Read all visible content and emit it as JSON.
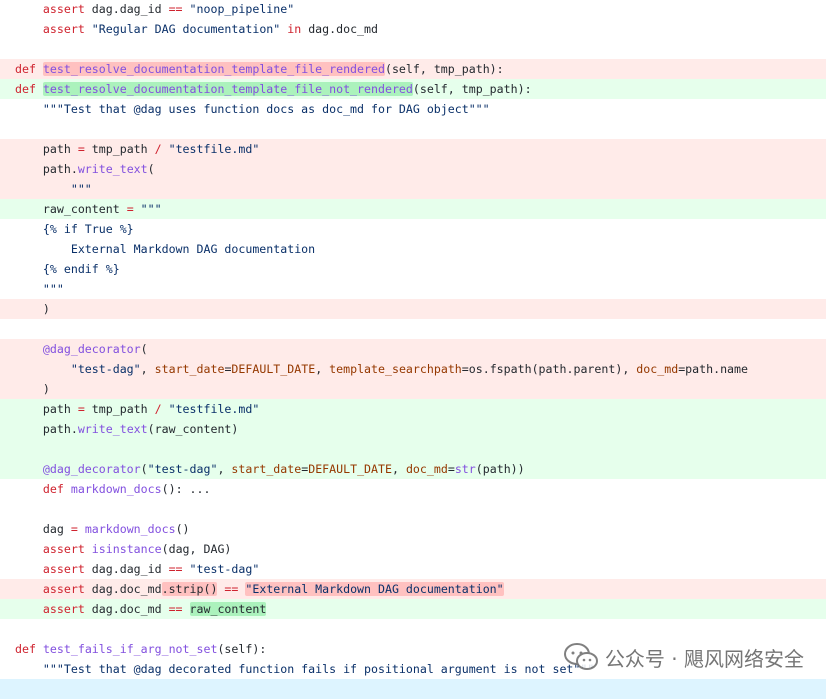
{
  "diff_lines": [
    {
      "type": "context",
      "tokens": [
        {
          "t": "    "
        },
        {
          "t": "assert",
          "c": "kw"
        },
        {
          "t": " dag.dag_id "
        },
        {
          "t": "==",
          "c": "op"
        },
        {
          "t": " "
        },
        {
          "t": "\"noop_pipeline\"",
          "c": "str"
        }
      ]
    },
    {
      "type": "context",
      "tokens": [
        {
          "t": "    "
        },
        {
          "t": "assert",
          "c": "kw"
        },
        {
          "t": " "
        },
        {
          "t": "\"Regular DAG documentation\"",
          "c": "str"
        },
        {
          "t": " "
        },
        {
          "t": "in",
          "c": "kw"
        },
        {
          "t": " dag.doc_md"
        }
      ]
    },
    {
      "type": "context",
      "tokens": []
    },
    {
      "type": "removed",
      "tokens": [
        {
          "t": "def",
          "c": "kw"
        },
        {
          "t": " "
        },
        {
          "t": "test_resolve_documentation_template_file_rendered",
          "c": "fn",
          "hl": true
        },
        {
          "t": "(self, tmp_path):"
        }
      ]
    },
    {
      "type": "added",
      "tokens": [
        {
          "t": "def",
          "c": "kw"
        },
        {
          "t": " "
        },
        {
          "t": "test_resolve_documentation_template_file_not_rendered",
          "c": "fn",
          "hl": true
        },
        {
          "t": "(self, tmp_path):"
        }
      ]
    },
    {
      "type": "context",
      "tokens": [
        {
          "t": "    "
        },
        {
          "t": "\"\"\"Test that @dag uses function docs as doc_md for DAG object\"\"\"",
          "c": "str"
        }
      ]
    },
    {
      "type": "context",
      "tokens": []
    },
    {
      "type": "removed",
      "tokens": [
        {
          "t": "    path "
        },
        {
          "t": "=",
          "c": "op"
        },
        {
          "t": " tmp_path "
        },
        {
          "t": "/",
          "c": "op"
        },
        {
          "t": " "
        },
        {
          "t": "\"testfile.md\"",
          "c": "str"
        }
      ]
    },
    {
      "type": "removed",
      "tokens": [
        {
          "t": "    path."
        },
        {
          "t": "write_text",
          "c": "fn"
        },
        {
          "t": "("
        }
      ]
    },
    {
      "type": "removed",
      "tokens": [
        {
          "t": "        "
        },
        {
          "t": "\"\"\"",
          "c": "str"
        }
      ]
    },
    {
      "type": "added",
      "tokens": [
        {
          "t": "    raw_content "
        },
        {
          "t": "=",
          "c": "op"
        },
        {
          "t": " "
        },
        {
          "t": "\"\"\"",
          "c": "str"
        }
      ]
    },
    {
      "type": "context",
      "tokens": [
        {
          "t": "    "
        },
        {
          "t": "{% if True %}",
          "c": "str"
        }
      ]
    },
    {
      "type": "context",
      "tokens": [
        {
          "t": "        "
        },
        {
          "t": "External Markdown DAG documentation",
          "c": "str"
        }
      ]
    },
    {
      "type": "context",
      "tokens": [
        {
          "t": "    "
        },
        {
          "t": "{% endif %}",
          "c": "str"
        }
      ]
    },
    {
      "type": "context",
      "tokens": [
        {
          "t": "    "
        },
        {
          "t": "\"\"\"",
          "c": "str"
        }
      ]
    },
    {
      "type": "removed",
      "tokens": [
        {
          "t": "    )"
        }
      ]
    },
    {
      "type": "context",
      "tokens": []
    },
    {
      "type": "removed",
      "tokens": [
        {
          "t": "    "
        },
        {
          "t": "@dag_decorator",
          "c": "dec"
        },
        {
          "t": "("
        }
      ]
    },
    {
      "type": "removed",
      "tokens": [
        {
          "t": "        "
        },
        {
          "t": "\"test-dag\"",
          "c": "str"
        },
        {
          "t": ", "
        },
        {
          "t": "start_date",
          "c": "param"
        },
        {
          "t": "="
        },
        {
          "t": "DEFAULT_DATE",
          "c": "const"
        },
        {
          "t": ", "
        },
        {
          "t": "template_searchpath",
          "c": "param"
        },
        {
          "t": "=os.fspath(path.parent), "
        },
        {
          "t": "doc_md",
          "c": "param"
        },
        {
          "t": "=path.name"
        }
      ]
    },
    {
      "type": "removed",
      "tokens": [
        {
          "t": "    )"
        }
      ]
    },
    {
      "type": "added",
      "tokens": [
        {
          "t": "    path "
        },
        {
          "t": "=",
          "c": "op"
        },
        {
          "t": " tmp_path "
        },
        {
          "t": "/",
          "c": "op"
        },
        {
          "t": " "
        },
        {
          "t": "\"testfile.md\"",
          "c": "str"
        }
      ]
    },
    {
      "type": "added",
      "tokens": [
        {
          "t": "    path."
        },
        {
          "t": "write_text",
          "c": "fn"
        },
        {
          "t": "(raw_content)"
        }
      ]
    },
    {
      "type": "added",
      "tokens": []
    },
    {
      "type": "added",
      "tokens": [
        {
          "t": "    "
        },
        {
          "t": "@dag_decorator",
          "c": "dec"
        },
        {
          "t": "("
        },
        {
          "t": "\"test-dag\"",
          "c": "str"
        },
        {
          "t": ", "
        },
        {
          "t": "start_date",
          "c": "param"
        },
        {
          "t": "="
        },
        {
          "t": "DEFAULT_DATE",
          "c": "const"
        },
        {
          "t": ", "
        },
        {
          "t": "doc_md",
          "c": "param"
        },
        {
          "t": "="
        },
        {
          "t": "str",
          "c": "fn"
        },
        {
          "t": "(path))"
        }
      ]
    },
    {
      "type": "context",
      "tokens": [
        {
          "t": "    "
        },
        {
          "t": "def",
          "c": "kw"
        },
        {
          "t": " "
        },
        {
          "t": "markdown_docs",
          "c": "fn"
        },
        {
          "t": "(): ..."
        }
      ]
    },
    {
      "type": "context",
      "tokens": []
    },
    {
      "type": "context",
      "tokens": [
        {
          "t": "    dag "
        },
        {
          "t": "=",
          "c": "op"
        },
        {
          "t": " "
        },
        {
          "t": "markdown_docs",
          "c": "fn"
        },
        {
          "t": "()"
        }
      ]
    },
    {
      "type": "context",
      "tokens": [
        {
          "t": "    "
        },
        {
          "t": "assert",
          "c": "kw"
        },
        {
          "t": " "
        },
        {
          "t": "isinstance",
          "c": "fn"
        },
        {
          "t": "(dag, DAG)"
        }
      ]
    },
    {
      "type": "context",
      "tokens": [
        {
          "t": "    "
        },
        {
          "t": "assert",
          "c": "kw"
        },
        {
          "t": " dag.dag_id "
        },
        {
          "t": "==",
          "c": "op"
        },
        {
          "t": " "
        },
        {
          "t": "\"test-dag\"",
          "c": "str"
        }
      ]
    },
    {
      "type": "removed",
      "tokens": [
        {
          "t": "    "
        },
        {
          "t": "assert",
          "c": "kw"
        },
        {
          "t": " dag.doc_md"
        },
        {
          "t": ".strip()",
          "hl": true
        },
        {
          "t": " "
        },
        {
          "t": "==",
          "c": "op"
        },
        {
          "t": " "
        },
        {
          "t": "\"External Markdown DAG documentation\"",
          "c": "str",
          "hl": true
        }
      ]
    },
    {
      "type": "added",
      "tokens": [
        {
          "t": "    "
        },
        {
          "t": "assert",
          "c": "kw"
        },
        {
          "t": " dag.doc_md "
        },
        {
          "t": "==",
          "c": "op"
        },
        {
          "t": " "
        },
        {
          "t": "raw_content",
          "hl": true
        }
      ]
    },
    {
      "type": "context",
      "tokens": []
    },
    {
      "type": "context",
      "tokens": [
        {
          "t": "def",
          "c": "kw"
        },
        {
          "t": " "
        },
        {
          "t": "test_fails_if_arg_not_set",
          "c": "fn"
        },
        {
          "t": "(self):"
        }
      ]
    },
    {
      "type": "context",
      "tokens": [
        {
          "t": "    "
        },
        {
          "t": "\"\"\"Test that @dag decorated function fails if positional argument is not set\"\"\"",
          "c": "str"
        }
      ]
    },
    {
      "type": "tail",
      "tokens": []
    }
  ],
  "watermark": {
    "icon": "wechat-icon",
    "text": "公众号 · 飓风网络安全"
  },
  "colors": {
    "removed_bg": "#ffebe9",
    "removed_hl": "#ffc1c0",
    "added_bg": "#e6ffec",
    "added_hl": "#abf2bc",
    "keyword": "#cf222e",
    "function": "#8250df",
    "string": "#0a3069",
    "constant": "#953800"
  }
}
